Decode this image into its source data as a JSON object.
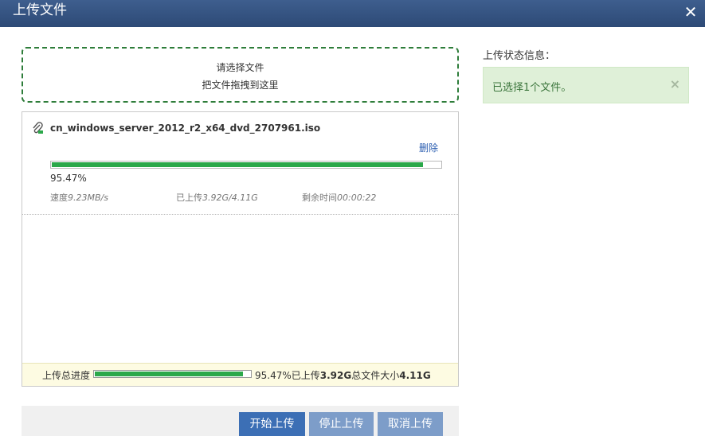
{
  "window": {
    "title": "上传文件",
    "close_glyph": "✕"
  },
  "dropzone": {
    "line1": "请选择文件",
    "line2": "把文件拖拽到这里"
  },
  "file": {
    "name": "cn_windows_server_2012_r2_x64_dvd_2707961.iso",
    "icon": "paperclip-icon",
    "delete_label": "删除",
    "progress": 0.9547,
    "progress_text": "95.47%",
    "speed_label": "速度",
    "speed_value": "9.23MB/s",
    "uploaded_label": "已上传",
    "uploaded_value": "3.92G/4.11G",
    "remaining_label": "剩余时间",
    "remaining_value": "00:00:22"
  },
  "total": {
    "label": "上传总进度",
    "progress": 0.9547,
    "percent_text": "95.47%已上传",
    "uploaded": "3.92G",
    "size_label": "总文件大小",
    "size": "4.11G"
  },
  "buttons": {
    "start": "开始上传",
    "stop": "停止上传",
    "cancel": "取消上传"
  },
  "status": {
    "title": "上传状态信息：",
    "message": "已选择1个文件。",
    "dismiss_glyph": "×"
  },
  "colors": {
    "titlebar": "#2d4a76",
    "progress": "#2ba84a",
    "primary_button": "#3c6fb5",
    "secondary_button": "#7d9dc9",
    "success_bg": "#dff0d8"
  }
}
